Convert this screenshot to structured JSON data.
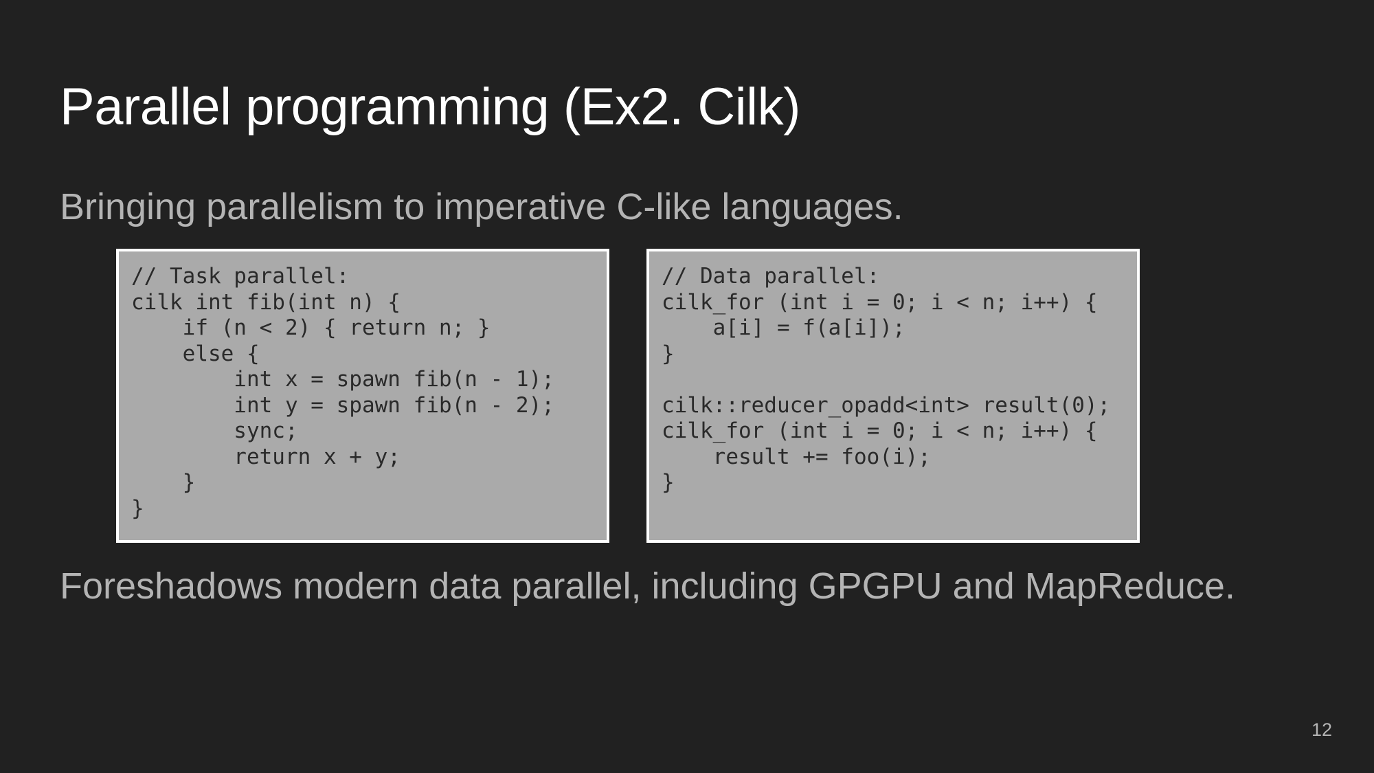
{
  "slide": {
    "title": "Parallel programming (Ex2. Cilk)",
    "subtitle": "Bringing parallelism to imperative C-like languages.",
    "code_left": "// Task parallel:\ncilk int fib(int n) {\n    if (n < 2) { return n; }\n    else {\n        int x = spawn fib(n - 1);\n        int y = spawn fib(n - 2);\n        sync;\n        return x + y;\n    }\n}",
    "code_right": "// Data parallel:\ncilk_for (int i = 0; i < n; i++) {\n    a[i] = f(a[i]);\n}\n\ncilk::reducer_opadd<int> result(0);\ncilk_for (int i = 0; i < n; i++) {\n    result += foo(i);\n}",
    "footer_text": "Foreshadows modern data parallel, including GPGPU and MapReduce.",
    "page_number": "12"
  },
  "colors": {
    "background": "#212121",
    "title": "#ffffff",
    "body_text": "#b4b4b4",
    "code_box_fill": "#aaaaaa",
    "code_box_border": "#ffffff"
  }
}
